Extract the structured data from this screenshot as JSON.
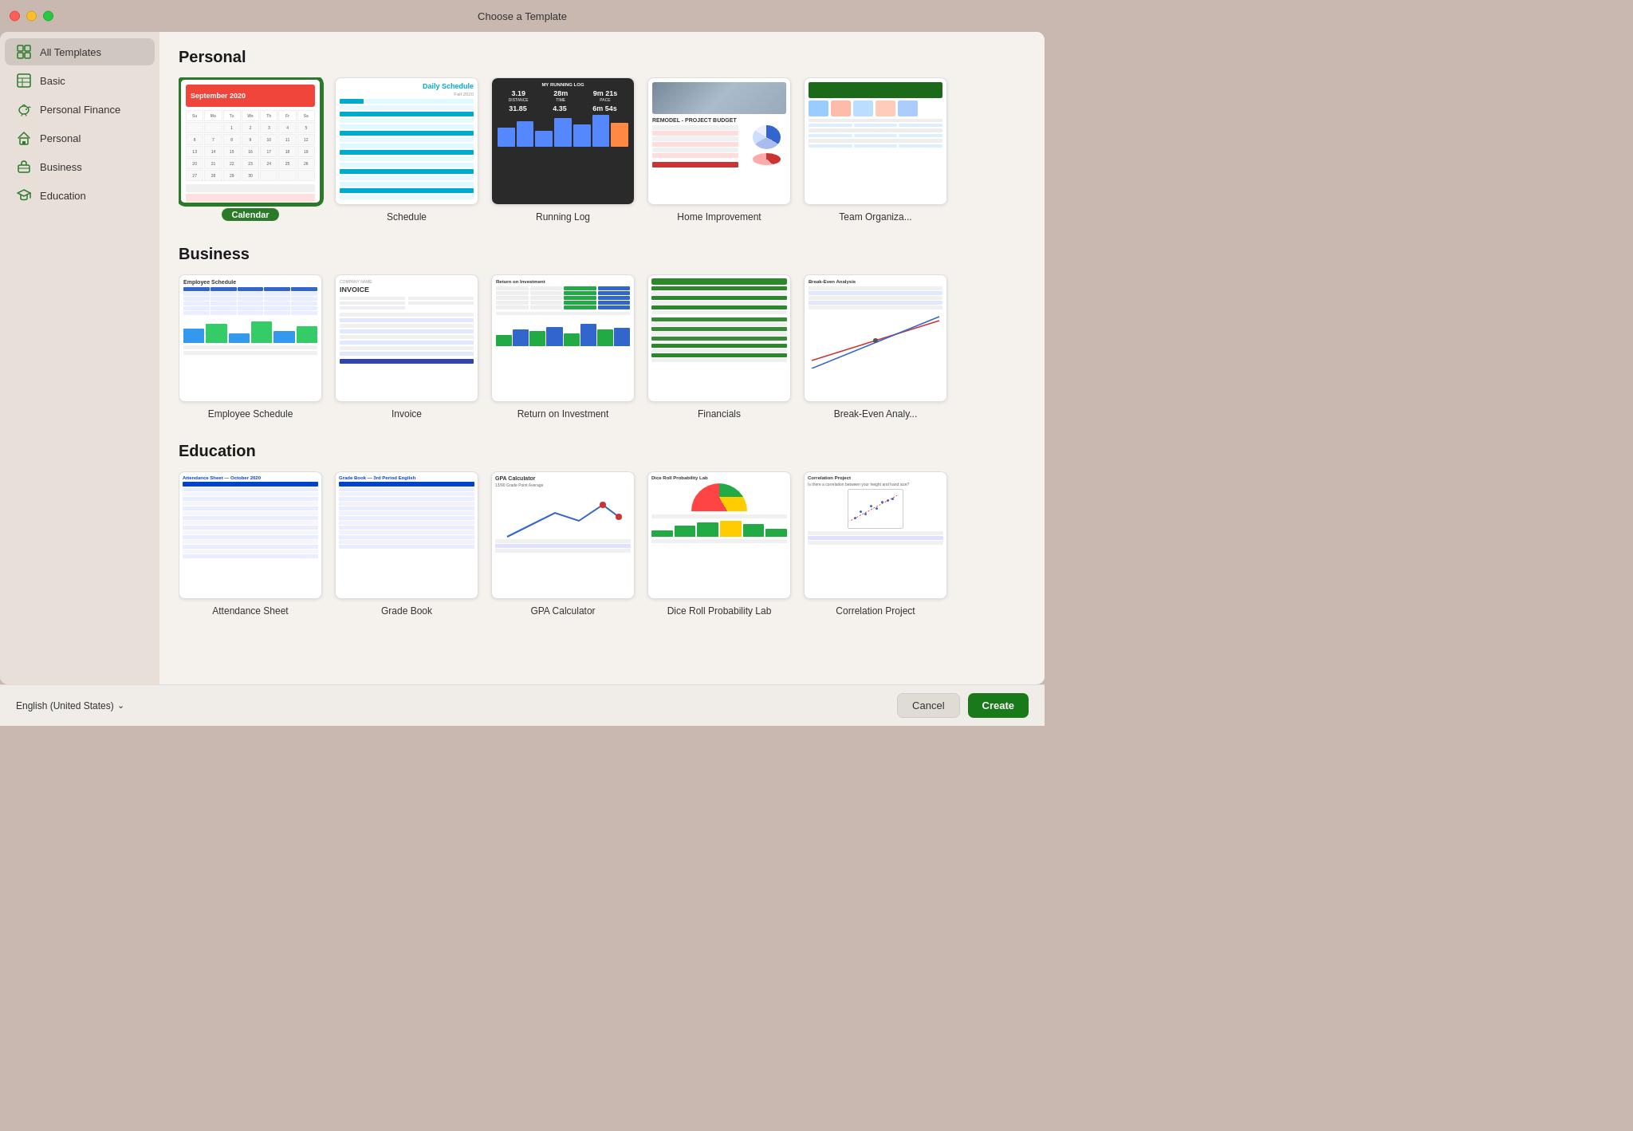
{
  "window": {
    "title": "Choose a Template"
  },
  "sidebar": {
    "items": [
      {
        "id": "all-templates",
        "label": "All Templates",
        "icon": "grid",
        "active": true
      },
      {
        "id": "basic",
        "label": "Basic",
        "icon": "table",
        "active": false
      },
      {
        "id": "personal-finance",
        "label": "Personal Finance",
        "icon": "piggy",
        "active": false
      },
      {
        "id": "personal",
        "label": "Personal",
        "icon": "home",
        "active": false
      },
      {
        "id": "business",
        "label": "Business",
        "icon": "briefcase",
        "active": false
      },
      {
        "id": "education",
        "label": "Education",
        "icon": "graduate",
        "active": false
      }
    ]
  },
  "sections": [
    {
      "id": "personal",
      "title": "Personal",
      "templates": [
        {
          "id": "calendar",
          "label": "Calendar",
          "selected": true
        },
        {
          "id": "schedule",
          "label": "Schedule",
          "selected": false
        },
        {
          "id": "running-log",
          "label": "Running Log",
          "selected": false
        },
        {
          "id": "home-improvement",
          "label": "Home Improvement",
          "selected": false
        },
        {
          "id": "team-organizer",
          "label": "Team Organiza...",
          "selected": false
        }
      ]
    },
    {
      "id": "business",
      "title": "Business",
      "templates": [
        {
          "id": "employee-schedule",
          "label": "Employee Schedule",
          "selected": false
        },
        {
          "id": "invoice",
          "label": "Invoice",
          "selected": false
        },
        {
          "id": "roi",
          "label": "Return on Investment",
          "selected": false
        },
        {
          "id": "financials",
          "label": "Financials",
          "selected": false
        },
        {
          "id": "break-even",
          "label": "Break-Even Analy...",
          "selected": false
        }
      ]
    },
    {
      "id": "education",
      "title": "Education",
      "templates": [
        {
          "id": "attendance",
          "label": "Attendance Sheet",
          "selected": false
        },
        {
          "id": "gradebook",
          "label": "Grade Book",
          "selected": false
        },
        {
          "id": "gpa",
          "label": "GPA Calculator",
          "selected": false
        },
        {
          "id": "dice",
          "label": "Dice Roll Probability Lab",
          "selected": false
        },
        {
          "id": "correlation",
          "label": "Correlation Project",
          "selected": false
        }
      ]
    }
  ],
  "bottom": {
    "language": "English (United States)",
    "cancel_label": "Cancel",
    "create_label": "Create"
  }
}
